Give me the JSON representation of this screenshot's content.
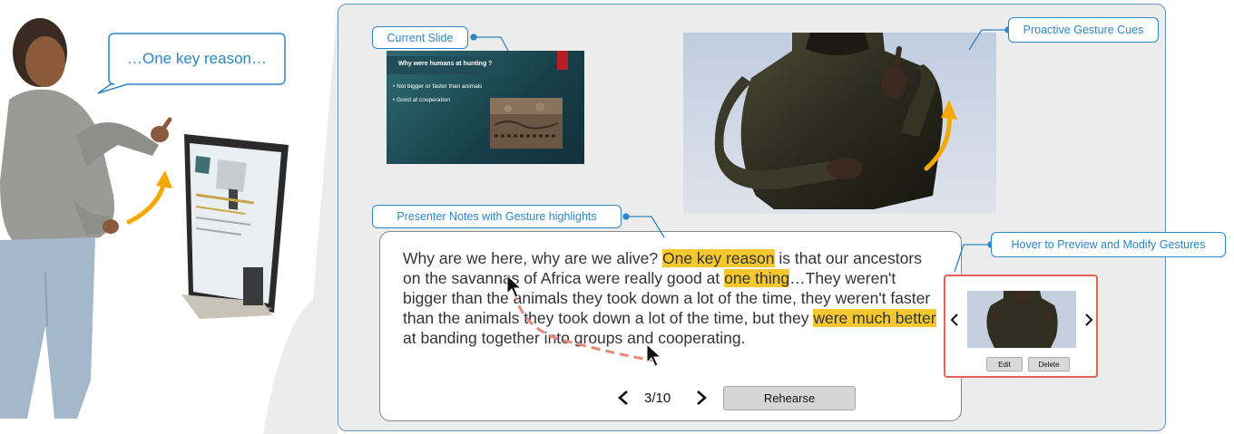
{
  "speech_bubble": "…One key reason…",
  "callouts": {
    "current_slide": "Current Slide",
    "gesture_cues": "Proactive Gesture Cues",
    "presenter_notes": "Presenter Notes with Gesture highlights",
    "hover_preview": "Hover to Preview and Modify Gestures"
  },
  "slide": {
    "title": "Why were humans at hunting ?",
    "bullets": [
      "Not bigger or faster than animals",
      "Good at cooperation"
    ],
    "accent_color": "#b81d24"
  },
  "notes": {
    "t1": "Why are we here, why are we alive? ",
    "h1": "One key reason",
    "t2": " is that our ancestors on the savannas of Africa were really good at ",
    "h2": "one thing",
    "t3": "…They weren't bigger than the animals they took down a lot of the time, they weren't faster than the animals they took down a lot of the time, but they ",
    "h3": "were much better",
    "t4": " at banding together into groups and cooperating.",
    "highlight_color": "#f6c830"
  },
  "navigation": {
    "page": "3/10",
    "rehearse_label": "Rehearse"
  },
  "gesture_preview": {
    "edit_label": "Edit",
    "delete_label": "Delete"
  },
  "colors": {
    "callout_blue": "#2d86c6",
    "arrow_orange": "#f5a800",
    "preview_border": "#e8605a"
  }
}
